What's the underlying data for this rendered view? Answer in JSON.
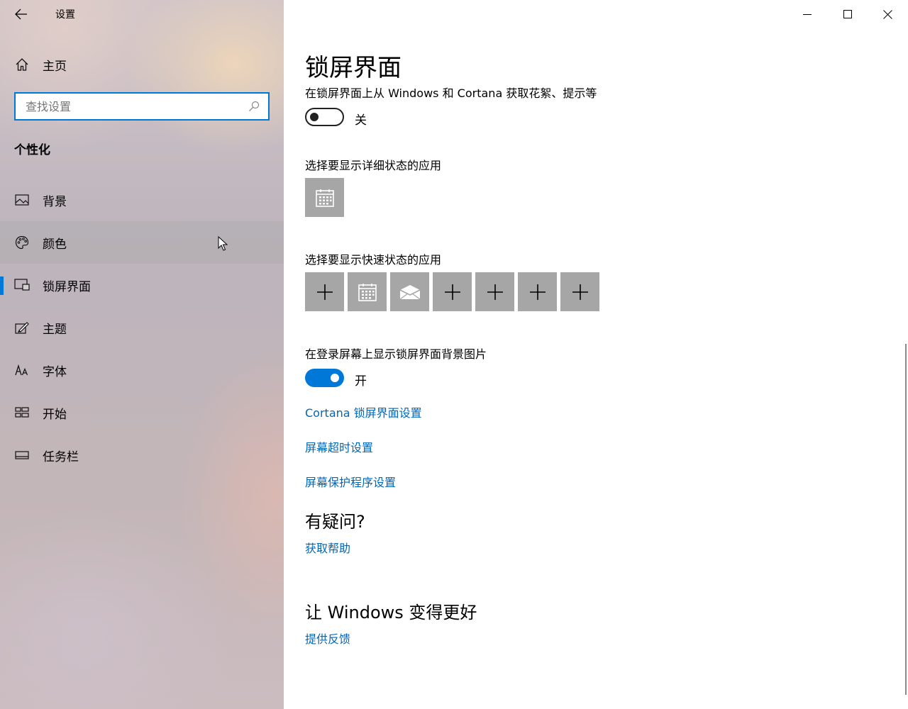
{
  "app": {
    "title": "设置"
  },
  "sidebar": {
    "home_label": "主页",
    "search_placeholder": "查找设置",
    "section_title": "个性化",
    "items": [
      {
        "label": "背景",
        "icon": "picture-icon"
      },
      {
        "label": "颜色",
        "icon": "palette-icon"
      },
      {
        "label": "锁屏界面",
        "icon": "lockscreen-icon"
      },
      {
        "label": "主题",
        "icon": "theme-brush-icon"
      },
      {
        "label": "字体",
        "icon": "font-icon"
      },
      {
        "label": "开始",
        "icon": "start-icon"
      },
      {
        "label": "任务栏",
        "icon": "taskbar-icon"
      }
    ],
    "active_item": "锁屏界面",
    "hover_item": "颜色"
  },
  "main": {
    "title": "锁屏界面",
    "tips_desc": "在锁屏界面上从 Windows 和 Cortana 获取花絮、提示等",
    "tips_toggle": {
      "state": "off",
      "label": "关"
    },
    "detailed_status_label": "选择要显示详细状态的应用",
    "detailed_status_app": "calendar-icon",
    "quick_status_label": "选择要显示快速状态的应用",
    "quick_status_apps": [
      "plus-icon",
      "calendar-icon",
      "mail-icon",
      "plus-icon",
      "plus-icon",
      "plus-icon",
      "plus-icon"
    ],
    "signin_bg_label": "在登录屏幕上显示锁屏界面背景图片",
    "signin_bg_toggle": {
      "state": "on",
      "label": "开"
    },
    "links": {
      "cortana": "Cortana 锁屏界面设置",
      "timeout": "屏幕超时设置",
      "screensaver": "屏幕保护程序设置"
    },
    "help_heading": "有疑问?",
    "help_link": "获取帮助",
    "feedback_heading": "让 Windows 变得更好",
    "feedback_link": "提供反馈"
  },
  "colors": {
    "accent": "#0078d7",
    "link": "#0067b8",
    "tile": "#a6a6a6"
  }
}
